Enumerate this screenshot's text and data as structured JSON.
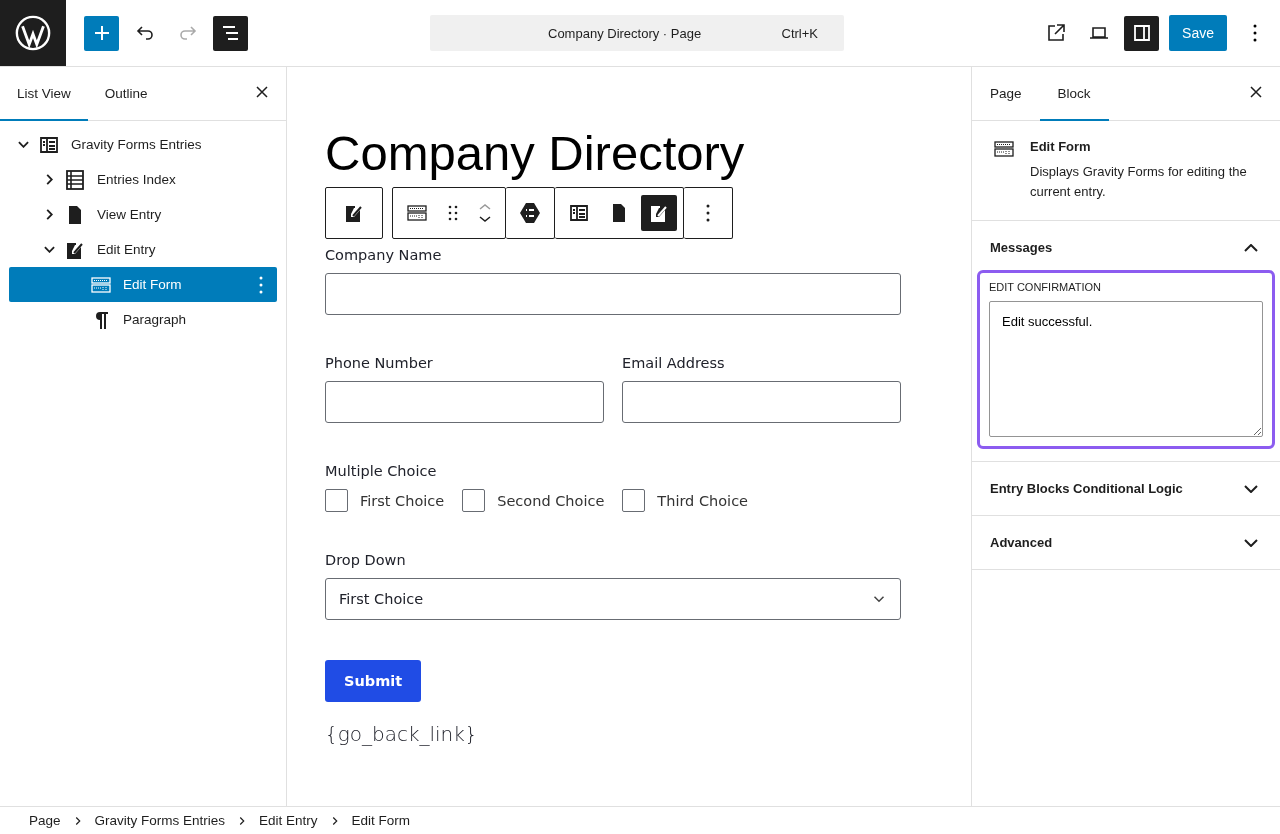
{
  "topbar": {
    "command": "Company Directory · Page",
    "shortcut": "Ctrl+K",
    "list_view_on": true,
    "sidebar_on": true,
    "save": "Save"
  },
  "left_panel": {
    "tabs": [
      {
        "label": "List View",
        "selected": true
      },
      {
        "label": "Outline",
        "selected": false
      }
    ],
    "tree": [
      {
        "label": "Gravity Forms Entries",
        "kind": "container",
        "expanded": true,
        "selected": false,
        "children": [
          {
            "label": "Entries Index",
            "kind": "table",
            "expanded": false,
            "selected": false
          },
          {
            "label": "View Entry",
            "kind": "document",
            "expanded": false,
            "selected": false
          },
          {
            "label": "Edit Entry",
            "kind": "edit",
            "expanded": true,
            "selected": false,
            "children": [
              {
                "label": "Edit Form",
                "kind": "form",
                "selected": true
              },
              {
                "label": "Paragraph",
                "kind": "paragraph",
                "selected": false
              }
            ]
          }
        ]
      }
    ]
  },
  "canvas": {
    "title": "Company Directory",
    "toolbar": [
      [
        {
          "kind": "edit",
          "selected": false
        }
      ],
      [
        {
          "kind": "form",
          "selected": false
        },
        {
          "kind": "drag",
          "selected": false
        },
        {
          "kind": "mover",
          "selected": false
        }
      ],
      [
        {
          "kind": "hexagon",
          "selected": false
        }
      ],
      [
        {
          "kind": "container",
          "selected": false
        },
        {
          "kind": "document",
          "selected": false
        },
        {
          "kind": "edit",
          "selected": true
        }
      ],
      [
        {
          "kind": "more",
          "selected": false
        }
      ]
    ],
    "rows": [
      [
        {
          "kind": "text",
          "label": "Company Name"
        }
      ],
      [
        {
          "kind": "text",
          "label": "Phone Number"
        },
        {
          "kind": "text",
          "label": "Email Address"
        }
      ],
      [
        {
          "kind": "checkboxes",
          "label": "Multiple Choice",
          "options": [
            {
              "label": "First Choice",
              "checked": false
            },
            {
              "label": "Second Choice",
              "checked": false
            },
            {
              "label": "Third Choice",
              "checked": false
            }
          ]
        }
      ],
      [
        {
          "kind": "select",
          "label": "Drop Down",
          "value": "First Choice"
        }
      ]
    ],
    "submit": "Submit",
    "link_text": "{go_back_link}"
  },
  "right_panel": {
    "tabs": [
      {
        "label": "Page",
        "selected": false
      },
      {
        "label": "Block",
        "selected": true
      }
    ],
    "block": {
      "name": "Edit Form",
      "description": "Displays Gravity Forms for editing the current entry."
    },
    "panels": [
      {
        "title": "Messages",
        "expanded": true,
        "field_label": "EDIT CONFIRMATION",
        "value": "Edit successful.",
        "focused": true
      },
      {
        "title": "Entry Blocks Conditional Logic",
        "expanded": false
      },
      {
        "title": "Advanced",
        "expanded": false
      }
    ]
  },
  "breadcrumb": [
    "Page",
    "Gravity Forms Entries",
    "Edit Entry",
    "Edit Form"
  ]
}
